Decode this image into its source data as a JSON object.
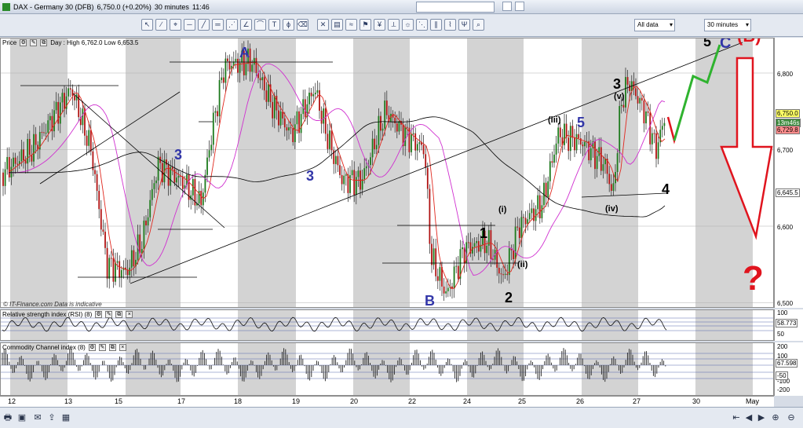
{
  "window": {
    "title": "DAX - Germany 30 (DFB)",
    "last": "6,750.0 (+0.20%)",
    "interval": "30 minutes",
    "time": "11:46"
  },
  "toolbar": {
    "data_filter": "All data",
    "interval_select": "30 minutes",
    "icons": [
      "cursor-icon",
      "draw-line-icon",
      "magnet-icon",
      "horizontal-line-icon",
      "trend-line-icon",
      "parallel-line-icon",
      "fan-icon",
      "angle-icon",
      "arc-icon",
      "text-tool-icon",
      "fibonacci-icon",
      "delete-icon",
      "clear-icon",
      "template-icon",
      "indicators-icon",
      "alerts-icon",
      "trade-icon",
      "ruler-icon",
      "sun-icon",
      "fib-fan-icon",
      "channel-icon",
      "zigzag-icon",
      "pitchfork-icon",
      "zoom-icon"
    ]
  },
  "price_pane": {
    "label": "Price",
    "ohlc": "Day : High 6,762.0 Low 6,653.5",
    "watermark": "© IT-Finance.com  Data is indicative",
    "ticks": [
      "6,800",
      "6,700",
      "6,600",
      "6,500"
    ],
    "last_price": "6,750.0",
    "countdown": "13m46s",
    "ma_value": "6,729.8",
    "ma200_value": "6,645.5"
  },
  "rsi_pane": {
    "label": "Relative strength index (RSI) (8)",
    "ticks": [
      "100",
      "50"
    ],
    "value": "58.773"
  },
  "cci_pane": {
    "label": "Commodity Channel index (8)",
    "ticks": [
      "200",
      "100",
      "0",
      "-100",
      "-200"
    ],
    "value": "67.598",
    "ref": "-50"
  },
  "x_axis": {
    "ticks": [
      "12",
      "13",
      "15",
      "17",
      "18",
      "19",
      "20",
      "22",
      "24",
      "25",
      "26",
      "27",
      "30",
      "May"
    ]
  },
  "annotations": {
    "A": "A",
    "B": "B",
    "C": "C",
    "B_paren": "(B)",
    "q": "?",
    "three_a": "3",
    "three_b": "3",
    "three_c": "3",
    "five_a": "5",
    "five_b": "5",
    "one": "1",
    "two": "2",
    "four": "4",
    "i": "(i)",
    "ii": "(ii)",
    "iii": "(iii)",
    "iv": "(iv)",
    "v": "(v)"
  },
  "colors": {
    "bar_up": "#1c7a1c",
    "bar_down": "#b01212",
    "ma_fast": "#e0281e",
    "ma_slow": "#d030d0",
    "ma_long": "#000000",
    "label_blue": "#3236a8",
    "arrow_red": "#e0141e",
    "arrow_green": "#2fb32f",
    "band": "#d3d3d3"
  }
}
